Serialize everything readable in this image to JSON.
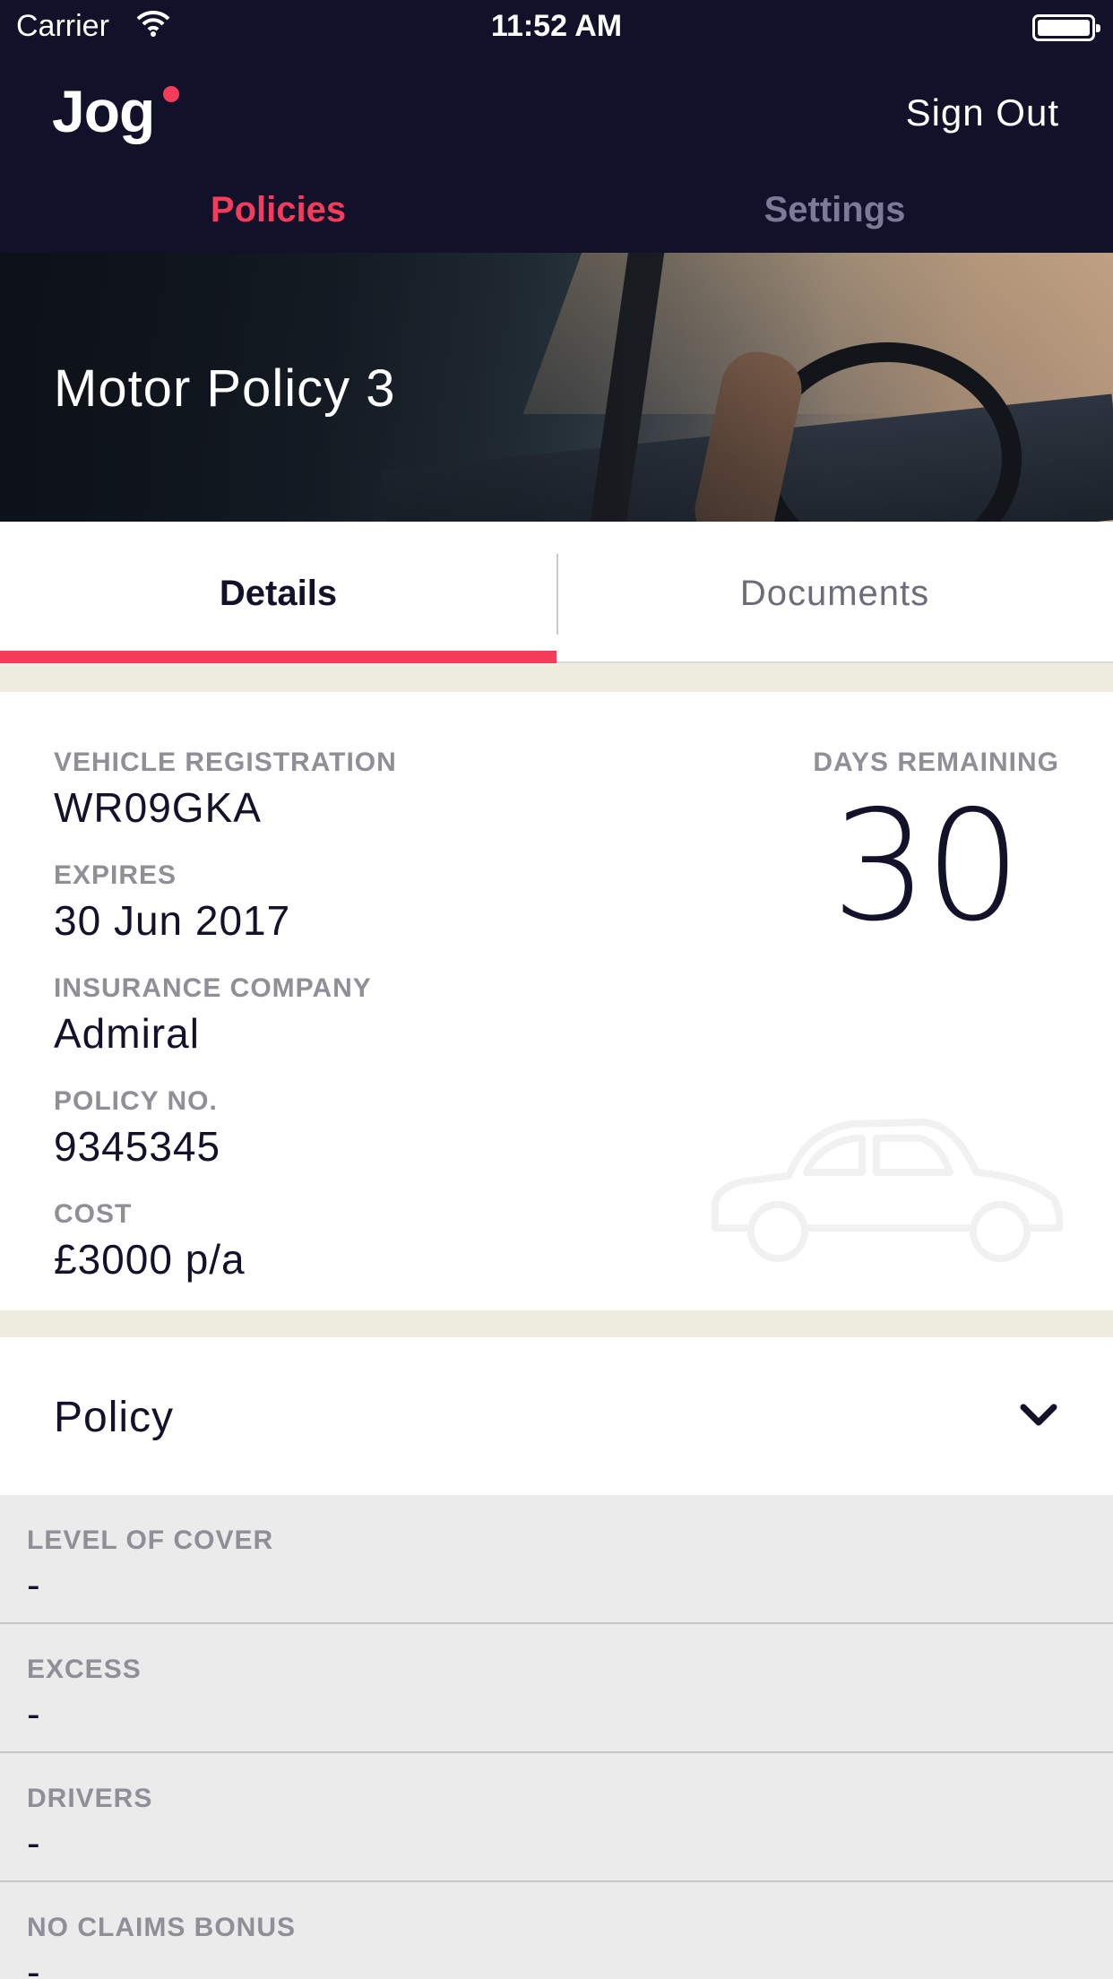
{
  "status_bar": {
    "carrier": "Carrier",
    "time": "11:52 AM"
  },
  "header": {
    "logo": "Jog",
    "sign_out": "Sign Out"
  },
  "nav_tabs": [
    {
      "label": "Policies"
    },
    {
      "label": "Settings"
    }
  ],
  "hero": {
    "title": "Motor Policy 3"
  },
  "segments": [
    {
      "label": "Details"
    },
    {
      "label": "Documents"
    }
  ],
  "details": {
    "vehicle_registration": {
      "label": "VEHICLE REGISTRATION",
      "value": "WR09GKA"
    },
    "expires": {
      "label": "EXPIRES",
      "value": "30 Jun 2017"
    },
    "insurance_company": {
      "label": "INSURANCE COMPANY",
      "value": "Admiral"
    },
    "policy_no": {
      "label": "POLICY NO.",
      "value": "9345345"
    },
    "cost": {
      "label": "COST",
      "value": "£3000 p/a"
    },
    "days_remaining": {
      "label": "DAYS REMAINING",
      "value": "30"
    }
  },
  "policy_section": {
    "title": "Policy",
    "rows": [
      {
        "label": "LEVEL OF COVER",
        "value": "-"
      },
      {
        "label": "EXCESS",
        "value": "-"
      },
      {
        "label": "DRIVERS",
        "value": "-"
      },
      {
        "label": "NO CLAIMS BONUS",
        "value": "-"
      }
    ]
  },
  "colors": {
    "accent": "#f53d5b",
    "navy": "#11112a",
    "background": "#efece0"
  }
}
